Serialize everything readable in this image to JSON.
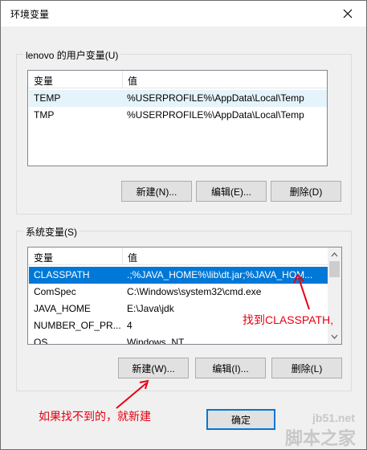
{
  "window": {
    "title": "环境变量"
  },
  "user_vars": {
    "label": "lenovo 的用户变量(U)",
    "headers": [
      "变量",
      "值"
    ],
    "rows": [
      {
        "name": "TEMP",
        "value": "%USERPROFILE%\\AppData\\Local\\Temp"
      },
      {
        "name": "TMP",
        "value": "%USERPROFILE%\\AppData\\Local\\Temp"
      }
    ],
    "buttons": {
      "new": "新建(N)...",
      "edit": "编辑(E)...",
      "delete": "删除(D)"
    }
  },
  "system_vars": {
    "label": "系统变量(S)",
    "headers": [
      "变量",
      "值"
    ],
    "rows": [
      {
        "name": "CLASSPATH",
        "value": ".;%JAVA_HOME%\\lib\\dt.jar;%JAVA_HOM..."
      },
      {
        "name": "ComSpec",
        "value": "C:\\Windows\\system32\\cmd.exe"
      },
      {
        "name": "JAVA_HOME",
        "value": "E:\\Java\\jdk"
      },
      {
        "name": "NUMBER_OF_PR...",
        "value": "4"
      },
      {
        "name": "OS",
        "value": "Windows_NT"
      }
    ],
    "buttons": {
      "new": "新建(W)...",
      "edit": "编辑(I)...",
      "delete": "删除(L)"
    }
  },
  "footer": {
    "ok": "确定"
  },
  "annotations": {
    "find_classpath": "找到CLASSPATH,",
    "create_if_missing": "如果找不到的，就新建",
    "color": "#e60012"
  },
  "watermark": {
    "site": "jb51.net",
    "brand": "脚本之家"
  },
  "icons": {
    "close": "close-icon",
    "arrow": "arrow-icon"
  }
}
